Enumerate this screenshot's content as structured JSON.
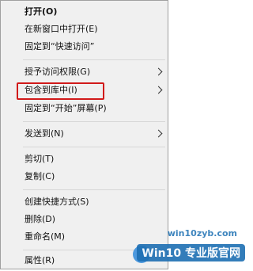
{
  "menu": {
    "items": [
      {
        "label": "打开(O)",
        "bold": true
      },
      {
        "label": "在新窗口中打开(E)"
      },
      {
        "label": "固定到“快速访问”"
      },
      {
        "label": "授予访问权限(G)",
        "submenu": true
      },
      {
        "label": "包含到库中(I)",
        "submenu": true,
        "highlighted": true
      },
      {
        "label": "固定到“开始”屏幕(P)"
      },
      {
        "label": "发送到(N)",
        "submenu": true
      },
      {
        "label": "剪切(T)"
      },
      {
        "label": "复制(C)"
      },
      {
        "label": "创建快捷方式(S)"
      },
      {
        "label": "删除(D)"
      },
      {
        "label": "重命名(M)"
      },
      {
        "label": "属性(R)"
      }
    ]
  },
  "highlight_color": "#d11a1a",
  "watermark": {
    "site": "win10zyb.com",
    "brand": "Win10 专业版官网"
  }
}
